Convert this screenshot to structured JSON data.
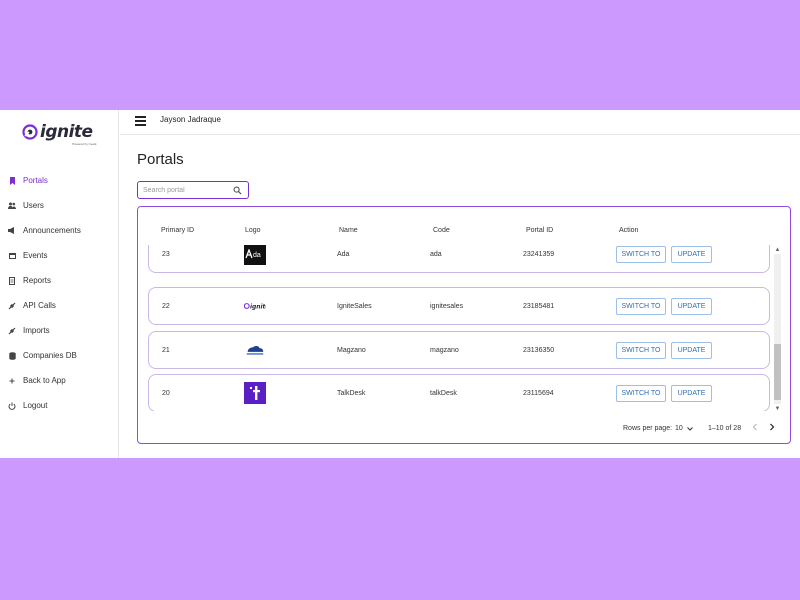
{
  "app": {
    "logo_text": "ignite",
    "logo_subtext": "Powered by Ceetk",
    "user_name": "Jayson Jadraque"
  },
  "sidebar": {
    "items": [
      {
        "label": "Portals",
        "icon": "bookmark-icon",
        "active": true
      },
      {
        "label": "Users",
        "icon": "users-icon",
        "active": false
      },
      {
        "label": "Announcements",
        "icon": "megaphone-icon",
        "active": false
      },
      {
        "label": "Events",
        "icon": "calendar-icon",
        "active": false
      },
      {
        "label": "Reports",
        "icon": "report-icon",
        "active": false
      },
      {
        "label": "API Calls",
        "icon": "plug-icon",
        "active": false
      },
      {
        "label": "Imports",
        "icon": "plug-icon",
        "active": false
      },
      {
        "label": "Companies DB",
        "icon": "database-icon",
        "active": false
      },
      {
        "label": "Back to App",
        "icon": "plus-icon",
        "active": false
      },
      {
        "label": "Logout",
        "icon": "power-icon",
        "active": false
      }
    ]
  },
  "main": {
    "title": "Portals",
    "search": {
      "placeholder": "Search portal",
      "value": ""
    }
  },
  "table": {
    "headers": [
      "Primary ID",
      "Logo",
      "Name",
      "Code",
      "Portal ID",
      "Action"
    ],
    "rows": [
      {
        "primary_id": "23",
        "logo": "ada-logo",
        "name": "Ada",
        "code": "ada",
        "portal_id": "23241359",
        "switch_label": "SWITCH TO",
        "update_label": "UPDATE"
      },
      {
        "primary_id": "22",
        "logo": "ignite-logo",
        "name": "IgniteSales",
        "code": "ignitesales",
        "portal_id": "23185481",
        "switch_label": "SWITCH TO",
        "update_label": "UPDATE"
      },
      {
        "primary_id": "21",
        "logo": "magzano-logo",
        "name": "Magzano",
        "code": "magzano",
        "portal_id": "23136350",
        "switch_label": "SWITCH TO",
        "update_label": "UPDATE"
      },
      {
        "primary_id": "20",
        "logo": "talkdesk-logo",
        "name": "TalkDesk",
        "code": "talkDesk",
        "portal_id": "23115694",
        "switch_label": "SWITCH TO",
        "update_label": "UPDATE"
      }
    ]
  },
  "pagination": {
    "rows_per_page_label": "Rows per page:",
    "rows_per_page_value": "10",
    "range_text": "1–10 of 28"
  },
  "colors": {
    "accent": "#7b2fd1",
    "background": "#cc99ff",
    "button_text": "#2f6fb5"
  }
}
